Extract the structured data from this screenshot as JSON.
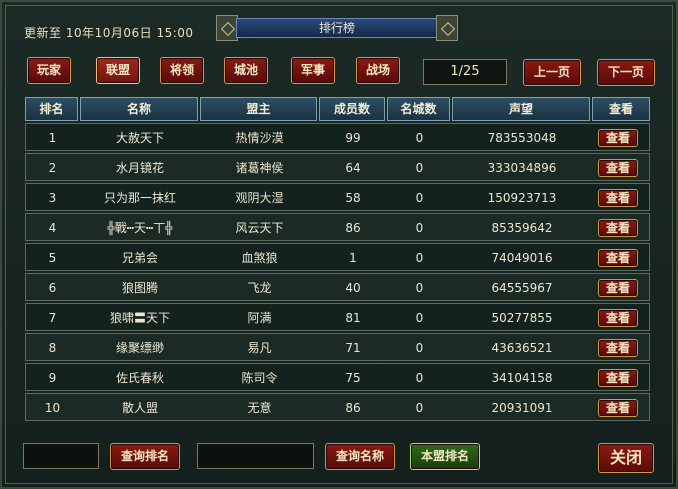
{
  "header": {
    "update_text": "更新至 10年10月06日 15:00",
    "title": "排行榜"
  },
  "tabs": [
    {
      "label": "玩家",
      "active": false
    },
    {
      "label": "联盟",
      "active": true
    },
    {
      "label": "将领",
      "active": false
    },
    {
      "label": "城池",
      "active": false
    },
    {
      "label": "军事",
      "active": false
    },
    {
      "label": "战场",
      "active": false
    }
  ],
  "pagination": {
    "indicator": "1/25",
    "prev_label": "上一页",
    "next_label": "下一页"
  },
  "table": {
    "columns": [
      "排名",
      "名称",
      "盟主",
      "成员数",
      "名城数",
      "声望",
      "查看"
    ],
    "view_label": "查看",
    "rows": [
      {
        "rank": "1",
        "name": "大赦天下",
        "leader": "热情沙漠",
        "members": "99",
        "cities": "0",
        "prestige": "783553048"
      },
      {
        "rank": "2",
        "name": "水月镜花",
        "leader": "诸葛神侯",
        "members": "64",
        "cities": "0",
        "prestige": "333034896"
      },
      {
        "rank": "3",
        "name": "只为那一抹红",
        "leader": "观阴大湿",
        "members": "58",
        "cities": "0",
        "prestige": "150923713"
      },
      {
        "rank": "4",
        "name": "╬戰┅天┅丅╬",
        "leader": "风云天下",
        "members": "86",
        "cities": "0",
        "prestige": "85359642"
      },
      {
        "rank": "5",
        "name": "兄弟会",
        "leader": "血煞狼",
        "members": "1",
        "cities": "0",
        "prestige": "74049016"
      },
      {
        "rank": "6",
        "name": "狼图腾",
        "leader": "飞龙",
        "members": "40",
        "cities": "0",
        "prestige": "64555967"
      },
      {
        "rank": "7",
        "name": "狼啸〓天下",
        "leader": "阿满",
        "members": "81",
        "cities": "0",
        "prestige": "50277855"
      },
      {
        "rank": "8",
        "name": "缘聚缥缈",
        "leader": "易凡",
        "members": "71",
        "cities": "0",
        "prestige": "43636521"
      },
      {
        "rank": "9",
        "name": "佐氏春秋",
        "leader": "陈司令",
        "members": "75",
        "cities": "0",
        "prestige": "34104158"
      },
      {
        "rank": "10",
        "name": "散人盟",
        "leader": "无意",
        "members": "86",
        "cities": "0",
        "prestige": "20931091"
      }
    ]
  },
  "footer": {
    "rank_query_value": "",
    "rank_query_label": "查询排名",
    "name_query_value": "",
    "name_query_label": "查询名称",
    "my_alliance_label": "本盟排名",
    "close_label": "关闭"
  }
}
